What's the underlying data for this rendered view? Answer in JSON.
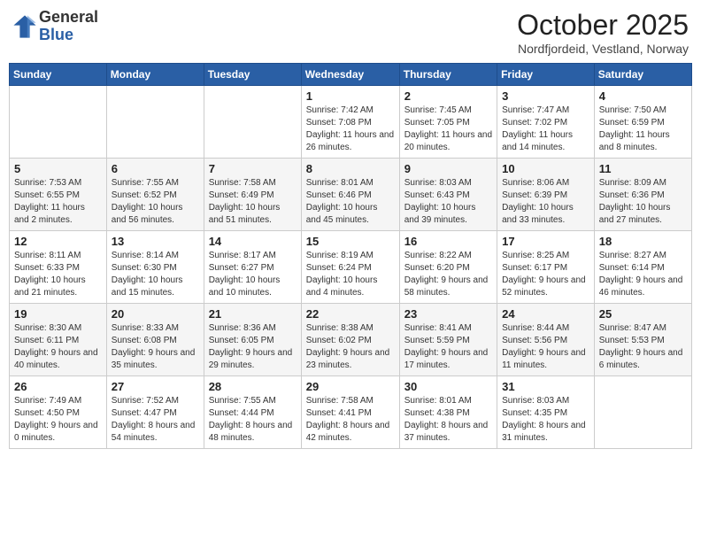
{
  "header": {
    "logo_general": "General",
    "logo_blue": "Blue",
    "month_title": "October 2025",
    "subtitle": "Nordfjordeid, Vestland, Norway"
  },
  "days_of_week": [
    "Sunday",
    "Monday",
    "Tuesday",
    "Wednesday",
    "Thursday",
    "Friday",
    "Saturday"
  ],
  "weeks": [
    [
      {
        "day": "",
        "content": ""
      },
      {
        "day": "",
        "content": ""
      },
      {
        "day": "",
        "content": ""
      },
      {
        "day": "1",
        "content": "Sunrise: 7:42 AM\nSunset: 7:08 PM\nDaylight: 11 hours and 26 minutes."
      },
      {
        "day": "2",
        "content": "Sunrise: 7:45 AM\nSunset: 7:05 PM\nDaylight: 11 hours and 20 minutes."
      },
      {
        "day": "3",
        "content": "Sunrise: 7:47 AM\nSunset: 7:02 PM\nDaylight: 11 hours and 14 minutes."
      },
      {
        "day": "4",
        "content": "Sunrise: 7:50 AM\nSunset: 6:59 PM\nDaylight: 11 hours and 8 minutes."
      }
    ],
    [
      {
        "day": "5",
        "content": "Sunrise: 7:53 AM\nSunset: 6:55 PM\nDaylight: 11 hours and 2 minutes."
      },
      {
        "day": "6",
        "content": "Sunrise: 7:55 AM\nSunset: 6:52 PM\nDaylight: 10 hours and 56 minutes."
      },
      {
        "day": "7",
        "content": "Sunrise: 7:58 AM\nSunset: 6:49 PM\nDaylight: 10 hours and 51 minutes."
      },
      {
        "day": "8",
        "content": "Sunrise: 8:01 AM\nSunset: 6:46 PM\nDaylight: 10 hours and 45 minutes."
      },
      {
        "day": "9",
        "content": "Sunrise: 8:03 AM\nSunset: 6:43 PM\nDaylight: 10 hours and 39 minutes."
      },
      {
        "day": "10",
        "content": "Sunrise: 8:06 AM\nSunset: 6:39 PM\nDaylight: 10 hours and 33 minutes."
      },
      {
        "day": "11",
        "content": "Sunrise: 8:09 AM\nSunset: 6:36 PM\nDaylight: 10 hours and 27 minutes."
      }
    ],
    [
      {
        "day": "12",
        "content": "Sunrise: 8:11 AM\nSunset: 6:33 PM\nDaylight: 10 hours and 21 minutes."
      },
      {
        "day": "13",
        "content": "Sunrise: 8:14 AM\nSunset: 6:30 PM\nDaylight: 10 hours and 15 minutes."
      },
      {
        "day": "14",
        "content": "Sunrise: 8:17 AM\nSunset: 6:27 PM\nDaylight: 10 hours and 10 minutes."
      },
      {
        "day": "15",
        "content": "Sunrise: 8:19 AM\nSunset: 6:24 PM\nDaylight: 10 hours and 4 minutes."
      },
      {
        "day": "16",
        "content": "Sunrise: 8:22 AM\nSunset: 6:20 PM\nDaylight: 9 hours and 58 minutes."
      },
      {
        "day": "17",
        "content": "Sunrise: 8:25 AM\nSunset: 6:17 PM\nDaylight: 9 hours and 52 minutes."
      },
      {
        "day": "18",
        "content": "Sunrise: 8:27 AM\nSunset: 6:14 PM\nDaylight: 9 hours and 46 minutes."
      }
    ],
    [
      {
        "day": "19",
        "content": "Sunrise: 8:30 AM\nSunset: 6:11 PM\nDaylight: 9 hours and 40 minutes."
      },
      {
        "day": "20",
        "content": "Sunrise: 8:33 AM\nSunset: 6:08 PM\nDaylight: 9 hours and 35 minutes."
      },
      {
        "day": "21",
        "content": "Sunrise: 8:36 AM\nSunset: 6:05 PM\nDaylight: 9 hours and 29 minutes."
      },
      {
        "day": "22",
        "content": "Sunrise: 8:38 AM\nSunset: 6:02 PM\nDaylight: 9 hours and 23 minutes."
      },
      {
        "day": "23",
        "content": "Sunrise: 8:41 AM\nSunset: 5:59 PM\nDaylight: 9 hours and 17 minutes."
      },
      {
        "day": "24",
        "content": "Sunrise: 8:44 AM\nSunset: 5:56 PM\nDaylight: 9 hours and 11 minutes."
      },
      {
        "day": "25",
        "content": "Sunrise: 8:47 AM\nSunset: 5:53 PM\nDaylight: 9 hours and 6 minutes."
      }
    ],
    [
      {
        "day": "26",
        "content": "Sunrise: 7:49 AM\nSunset: 4:50 PM\nDaylight: 9 hours and 0 minutes."
      },
      {
        "day": "27",
        "content": "Sunrise: 7:52 AM\nSunset: 4:47 PM\nDaylight: 8 hours and 54 minutes."
      },
      {
        "day": "28",
        "content": "Sunrise: 7:55 AM\nSunset: 4:44 PM\nDaylight: 8 hours and 48 minutes."
      },
      {
        "day": "29",
        "content": "Sunrise: 7:58 AM\nSunset: 4:41 PM\nDaylight: 8 hours and 42 minutes."
      },
      {
        "day": "30",
        "content": "Sunrise: 8:01 AM\nSunset: 4:38 PM\nDaylight: 8 hours and 37 minutes."
      },
      {
        "day": "31",
        "content": "Sunrise: 8:03 AM\nSunset: 4:35 PM\nDaylight: 8 hours and 31 minutes."
      },
      {
        "day": "",
        "content": ""
      }
    ]
  ]
}
